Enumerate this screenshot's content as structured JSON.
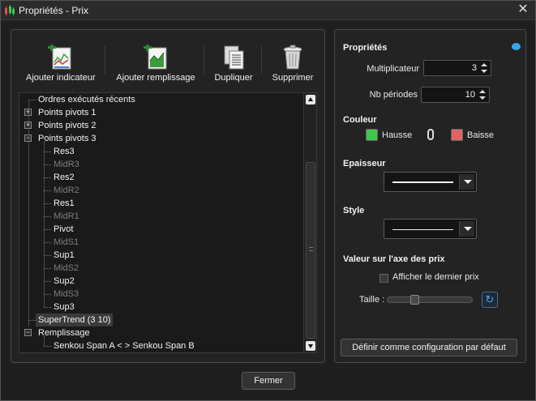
{
  "window": {
    "title": "Propriétés - Prix"
  },
  "toolbar": {
    "add_indicator": "Ajouter indicateur",
    "add_fill": "Ajouter remplissage",
    "duplicate": "Dupliquer",
    "delete": "Supprimer"
  },
  "tree": {
    "items": [
      {
        "label": "Ordres exécutés récents",
        "level": 0,
        "expander": "none",
        "muted": false
      },
      {
        "label": "Points pivots 1",
        "level": 0,
        "expander": "+",
        "muted": false
      },
      {
        "label": "Points pivots 2",
        "level": 0,
        "expander": "+",
        "muted": false
      },
      {
        "label": "Points pivots 3",
        "level": 0,
        "expander": "-",
        "muted": false
      },
      {
        "label": "Res3",
        "level": 1,
        "expander": "none",
        "muted": false
      },
      {
        "label": "MidR3",
        "level": 1,
        "expander": "none",
        "muted": true
      },
      {
        "label": "Res2",
        "level": 1,
        "expander": "none",
        "muted": false
      },
      {
        "label": "MidR2",
        "level": 1,
        "expander": "none",
        "muted": true
      },
      {
        "label": "Res1",
        "level": 1,
        "expander": "none",
        "muted": false
      },
      {
        "label": "MidR1",
        "level": 1,
        "expander": "none",
        "muted": true
      },
      {
        "label": "Pivot",
        "level": 1,
        "expander": "none",
        "muted": false
      },
      {
        "label": "MidS1",
        "level": 1,
        "expander": "none",
        "muted": true
      },
      {
        "label": "Sup1",
        "level": 1,
        "expander": "none",
        "muted": false
      },
      {
        "label": "MidS2",
        "level": 1,
        "expander": "none",
        "muted": true
      },
      {
        "label": "Sup2",
        "level": 1,
        "expander": "none",
        "muted": false
      },
      {
        "label": "MidS3",
        "level": 1,
        "expander": "none",
        "muted": true
      },
      {
        "label": "Sup3",
        "level": 1,
        "expander": "none",
        "muted": false
      },
      {
        "label": "SuperTrend (3 10)",
        "level": 0,
        "expander": "none",
        "muted": false,
        "selected": true
      },
      {
        "label": "Remplissage",
        "level": 0,
        "expander": "-",
        "muted": false
      },
      {
        "label": "Senkou Span A < > Senkou Span B",
        "level": 1,
        "expander": "none",
        "muted": false
      }
    ]
  },
  "properties": {
    "title": "Propriétés",
    "multiplier_label": "Multiplicateur",
    "multiplier_value": "3",
    "periods_label": "Nb périodes",
    "periods_value": "10",
    "color_title": "Couleur",
    "rise_label": "Hausse",
    "fall_label": "Baisse",
    "rise_color": "#3cc84a",
    "fall_color": "#e06464",
    "thickness_title": "Epaisseur",
    "style_title": "Style",
    "axis_title": "Valeur sur l'axe des prix",
    "show_last_price_label": "Afficher le dernier prix",
    "show_last_price_checked": false,
    "size_label": "Taille :",
    "size_level": 0.3,
    "set_default_label": "Définir comme configuration par défaut"
  },
  "footer": {
    "close_label": "Fermer"
  }
}
